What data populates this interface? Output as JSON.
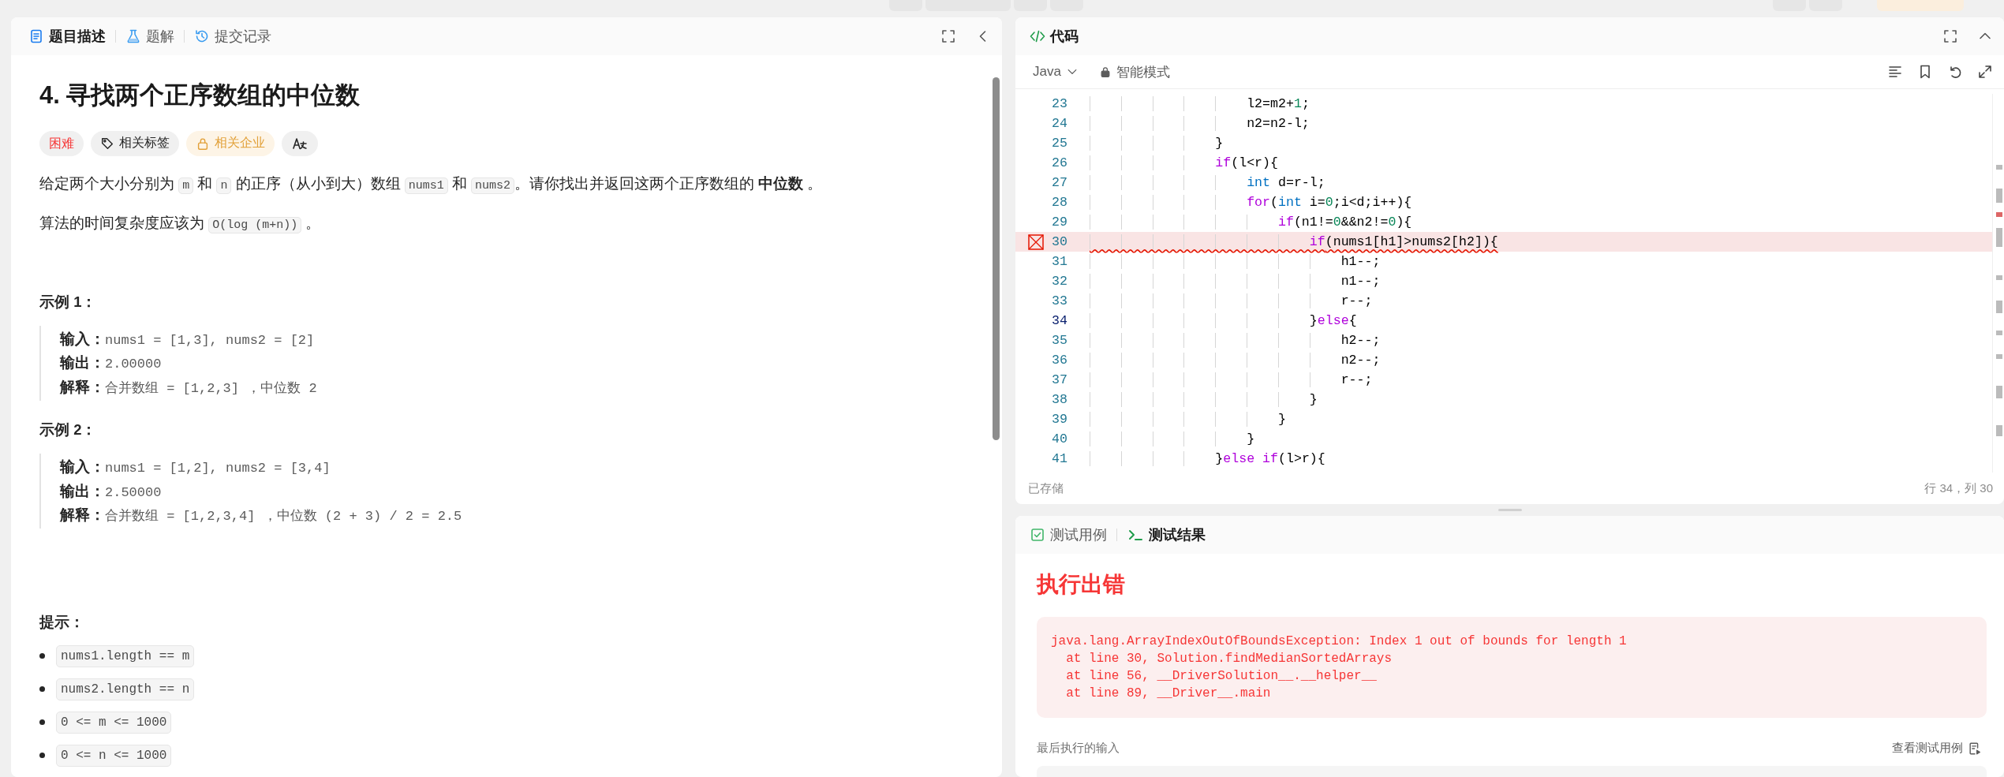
{
  "problem_panel": {
    "tabs": [
      {
        "kind": "description",
        "label": "题目描述",
        "selected": true
      },
      {
        "kind": "solutions",
        "label": "题解",
        "selected": false
      },
      {
        "kind": "submissions",
        "label": "提交记录",
        "selected": false
      }
    ],
    "title": "4. 寻找两个正序数组的中位数",
    "tags": [
      {
        "kind": "difficulty",
        "label": "困难"
      },
      {
        "kind": "topics",
        "label": "相关标签"
      },
      {
        "kind": "companies",
        "label": "相关企业"
      },
      {
        "kind": "translate"
      }
    ],
    "description": [
      [
        {
          "kind": "text",
          "text": "给定两个大小分别为 "
        },
        {
          "kind": "code",
          "text": "m"
        },
        {
          "kind": "text",
          "text": " 和 "
        },
        {
          "kind": "code",
          "text": "n"
        },
        {
          "kind": "text",
          "text": " 的正序（从小到大）数组 "
        },
        {
          "kind": "code",
          "text": "nums1"
        },
        {
          "kind": "text",
          "text": " 和 "
        },
        {
          "kind": "code",
          "text": "nums2"
        },
        {
          "kind": "text",
          "text": "。请你找出并返回这两个正序数组的 "
        },
        {
          "kind": "bold",
          "text": "中位数"
        },
        {
          "kind": "text",
          "text": " 。"
        }
      ],
      [
        {
          "kind": "text",
          "text": "算法的时间复杂度应该为 "
        },
        {
          "kind": "code",
          "text": "O(log (m+n))"
        },
        {
          "kind": "text",
          "text": " 。"
        }
      ]
    ],
    "examples": [
      {
        "heading": "示例 1：",
        "lines": [
          {
            "label": "输入：",
            "value": "nums1 = [1,3], nums2 = [2]"
          },
          {
            "label": "输出：",
            "value": "2.00000"
          },
          {
            "label": "解释：",
            "value": "合并数组 = [1,2,3] ，中位数 2"
          }
        ]
      },
      {
        "heading": "示例 2：",
        "lines": [
          {
            "label": "输入：",
            "value": "nums1 = [1,2], nums2 = [3,4]"
          },
          {
            "label": "输出：",
            "value": "2.50000"
          },
          {
            "label": "解释：",
            "value": "合并数组 = [1,2,3,4] ，中位数 (2 + 3) / 2 = 2.5"
          }
        ]
      }
    ],
    "hints_heading": "提示：",
    "hints": [
      "nums1.length == m",
      "nums2.length == n",
      "0 <= m <= 1000",
      "0 <= n <= 1000"
    ]
  },
  "code_panel": {
    "title": "代码",
    "language": "Java",
    "mode": "智能模式",
    "lines": [
      {
        "number": "23",
        "error": false,
        "current": false,
        "segments": [
          {
            "kind": "plain",
            "text": "                    l2=m2+"
          },
          {
            "kind": "number",
            "text": "1"
          },
          {
            "kind": "plain",
            "text": ";"
          }
        ]
      },
      {
        "number": "24",
        "error": false,
        "current": false,
        "segments": [
          {
            "kind": "plain",
            "text": "                    n2=n2-l;"
          }
        ]
      },
      {
        "number": "25",
        "error": false,
        "current": false,
        "segments": [
          {
            "kind": "plain",
            "text": "                }"
          }
        ]
      },
      {
        "number": "26",
        "error": false,
        "current": false,
        "segments": [
          {
            "kind": "keyword",
            "text": "                if"
          },
          {
            "kind": "plain",
            "text": "(l<r){"
          }
        ]
      },
      {
        "number": "27",
        "error": false,
        "current": false,
        "segments": [
          {
            "kind": "type",
            "text": "                    int"
          },
          {
            "kind": "plain",
            "text": " d=r-l;"
          }
        ]
      },
      {
        "number": "28",
        "error": false,
        "current": false,
        "segments": [
          {
            "kind": "keyword",
            "text": "                    for"
          },
          {
            "kind": "plain",
            "text": "("
          },
          {
            "kind": "type",
            "text": "int"
          },
          {
            "kind": "plain",
            "text": " i="
          },
          {
            "kind": "number",
            "text": "0"
          },
          {
            "kind": "plain",
            "text": ";i<d;i++){"
          }
        ]
      },
      {
        "number": "29",
        "error": false,
        "current": false,
        "segments": [
          {
            "kind": "keyword",
            "text": "                        if"
          },
          {
            "kind": "plain",
            "text": "(n1!="
          },
          {
            "kind": "number",
            "text": "0"
          },
          {
            "kind": "plain",
            "text": "&&n2!="
          },
          {
            "kind": "number",
            "text": "0"
          },
          {
            "kind": "plain",
            "text": "){"
          }
        ]
      },
      {
        "number": "30",
        "error": true,
        "current": false,
        "segments": [
          {
            "kind": "keyword",
            "text": "                            if"
          },
          {
            "kind": "plain",
            "text": "(nums1[h1]>nums2[h2]){"
          }
        ]
      },
      {
        "number": "31",
        "error": false,
        "current": false,
        "segments": [
          {
            "kind": "plain",
            "text": "                                h1--;"
          }
        ]
      },
      {
        "number": "32",
        "error": false,
        "current": false,
        "segments": [
          {
            "kind": "plain",
            "text": "                                n1--;"
          }
        ]
      },
      {
        "number": "33",
        "error": false,
        "current": false,
        "segments": [
          {
            "kind": "plain",
            "text": "                                r--;"
          }
        ]
      },
      {
        "number": "34",
        "error": false,
        "current": true,
        "segments": [
          {
            "kind": "plain",
            "text": "                            }"
          },
          {
            "kind": "keyword",
            "text": "else"
          },
          {
            "kind": "plain",
            "text": "{"
          }
        ]
      },
      {
        "number": "35",
        "error": false,
        "current": false,
        "segments": [
          {
            "kind": "plain",
            "text": "                                h2--;"
          }
        ]
      },
      {
        "number": "36",
        "error": false,
        "current": false,
        "segments": [
          {
            "kind": "plain",
            "text": "                                n2--;"
          }
        ]
      },
      {
        "number": "37",
        "error": false,
        "current": false,
        "segments": [
          {
            "kind": "plain",
            "text": "                                r--;"
          }
        ]
      },
      {
        "number": "38",
        "error": false,
        "current": false,
        "segments": [
          {
            "kind": "plain",
            "text": "                            }"
          }
        ]
      },
      {
        "number": "39",
        "error": false,
        "current": false,
        "segments": [
          {
            "kind": "plain",
            "text": "                        }"
          }
        ]
      },
      {
        "number": "40",
        "error": false,
        "current": false,
        "segments": [
          {
            "kind": "plain",
            "text": "                    }"
          }
        ]
      },
      {
        "number": "41",
        "error": false,
        "current": false,
        "segments": [
          {
            "kind": "plain",
            "text": "                }"
          },
          {
            "kind": "keyword",
            "text": "else if"
          },
          {
            "kind": "plain",
            "text": "(l>r){"
          }
        ]
      }
    ],
    "saved_status": "已存储",
    "cursor_position": "行 34，列 30"
  },
  "result_panel": {
    "tabs": [
      {
        "kind": "testcase",
        "label": "测试用例",
        "selected": false
      },
      {
        "kind": "result",
        "label": "测试结果",
        "selected": true
      }
    ],
    "status": "执行出错",
    "error_lines": [
      "java.lang.ArrayIndexOutOfBoundsException: Index 1 out of bounds for length 1",
      "  at line 30, Solution.findMedianSortedArrays",
      "  at line 56, __DriverSolution__.__helper__",
      "  at line 89, __Driver__.main"
    ],
    "last_input_label": "最后执行的输入",
    "view_testcases_link": "查看测试用例"
  }
}
